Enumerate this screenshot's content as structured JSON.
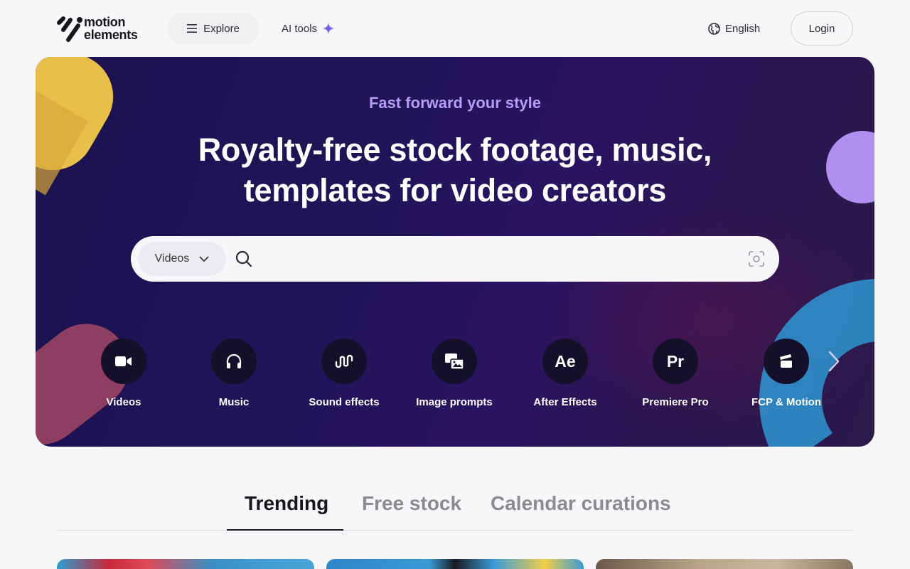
{
  "header": {
    "logo_line1": "motion",
    "logo_line2": "elements",
    "explore_label": "Explore",
    "ai_tools_label": "AI tools",
    "language_label": "English",
    "login_label": "Login"
  },
  "hero": {
    "tagline": "Fast forward your style",
    "headline_line1": "Royalty-free stock footage, music,",
    "headline_line2": "templates for video creators",
    "search": {
      "type_label": "Videos",
      "placeholder": "",
      "value": ""
    },
    "categories": [
      {
        "label": "Videos",
        "icon": "video-camera-icon"
      },
      {
        "label": "Music",
        "icon": "headphones-icon"
      },
      {
        "label": "Sound effects",
        "icon": "soundwave-icon"
      },
      {
        "label": "Image prompts",
        "icon": "image-prompt-icon"
      },
      {
        "label": "After Effects",
        "icon": "after-effects-icon",
        "glyph": "Ae"
      },
      {
        "label": "Premiere Pro",
        "icon": "premiere-pro-icon",
        "glyph": "Pr"
      },
      {
        "label": "FCP & Motion",
        "icon": "clapperboard-icon"
      }
    ]
  },
  "tabs": [
    {
      "label": "Trending",
      "active": true
    },
    {
      "label": "Free stock",
      "active": false
    },
    {
      "label": "Calendar curations",
      "active": false
    }
  ],
  "colors": {
    "hero_bg": "#1f1457",
    "tagline": "#b79cf5",
    "ai_spark": "#7c5ce6",
    "accent_yellow": "#f4c94b",
    "accent_purple": "#b18ff0",
    "accent_blue": "#2f89c4"
  }
}
